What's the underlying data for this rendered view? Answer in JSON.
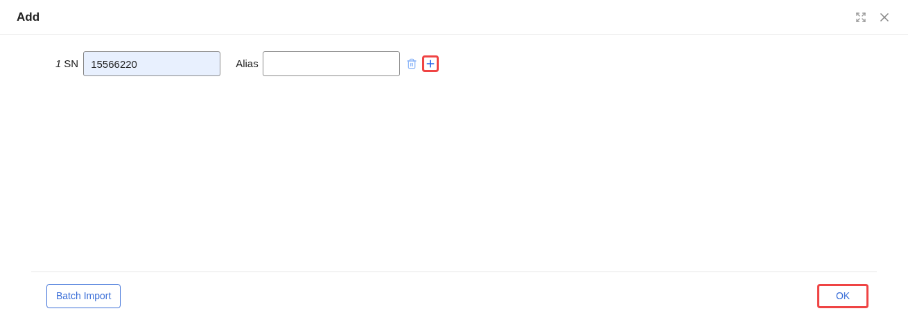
{
  "dialog": {
    "title": "Add"
  },
  "rows": [
    {
      "index": "1",
      "sn_label": "SN",
      "sn_value": "15566220",
      "alias_label": "Alias",
      "alias_value": "",
      "add_highlighted": true
    }
  ],
  "footer": {
    "buttons": [
      {
        "label": "Batch Import",
        "highlighted": false
      },
      {
        "label": "OK",
        "highlighted": true
      }
    ]
  }
}
